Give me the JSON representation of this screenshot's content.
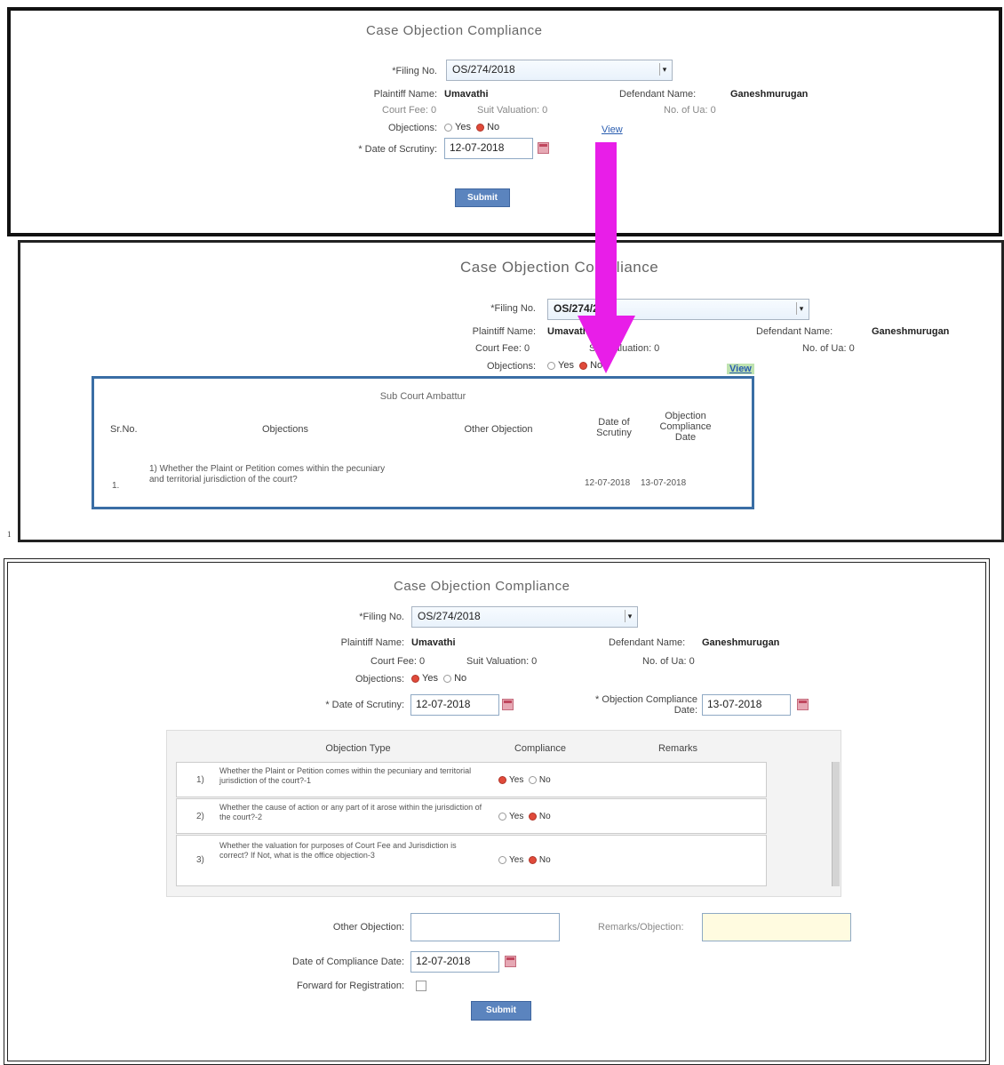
{
  "panel1": {
    "title": "Case Objection Compliance",
    "filing_label": "*Filing No.",
    "filing_value": "OS/274/2018",
    "plaintiff_label": "Plaintiff Name:",
    "plaintiff_value": "Umavathi",
    "defendant_label": "Defendant Name:",
    "defendant_value": "Ganeshmurugan",
    "court_fee": "Court Fee: 0",
    "suit_valuation": "Suit Valuation: 0",
    "no_of_ua": "No. of Ua: 0",
    "objections_label": "Objections:",
    "yes_label": "Yes",
    "no_label": "No",
    "view_link": "View",
    "date_label": "* Date of Scrutiny:",
    "date_value": "12-07-2018",
    "submit_label": "Submit"
  },
  "panel2": {
    "title": "Case Objection Compliance",
    "filing_label": "*Filing No.",
    "filing_value": "OS/274/2018",
    "plaintiff_label": "Plaintiff Name:",
    "plaintiff_value": "Umavathi",
    "defendant_label": "Defendant Name:",
    "defendant_value": "Ganeshmurugan",
    "court_fee": "Court Fee: 0",
    "suit_valuation": "Suit Valuation: 0",
    "no_of_ua": "No. of Ua: 0",
    "objections_label": "Objections:",
    "yes_label": "Yes",
    "no_label": "No",
    "view_link": "View",
    "popup": {
      "title": "Sub Court Ambattur",
      "headers": [
        "Sr.No.",
        "Objections",
        "Other Objection",
        "Date of Scrutiny",
        "Objection Compliance Date"
      ],
      "row": {
        "sr": "1.",
        "objection": "1) Whether the Plaint or Petition comes within the pecuniary and territorial jurisdiction of the court?",
        "other": "",
        "scrutiny_date": "12-07-2018",
        "compliance_date": "13-07-2018"
      }
    },
    "footnote": "1"
  },
  "panel3": {
    "title": "Case Objection Compliance",
    "filing_label": "*Filing No.",
    "filing_value": "OS/274/2018",
    "plaintiff_label": "Plaintiff Name:",
    "plaintiff_value": "Umavathi",
    "defendant_label": "Defendant Name:",
    "defendant_value": "Ganeshmurugan",
    "court_fee": "Court Fee: 0",
    "suit_valuation": "Suit Valuation: 0",
    "no_of_ua": "No. of Ua: 0",
    "objections_label": "Objections:",
    "yes_label": "Yes",
    "no_label": "No",
    "scrutiny_label": "* Date of Scrutiny:",
    "scrutiny_value": "12-07-2018",
    "compliance_label": "* Objection Compliance Date:",
    "compliance_value": "13-07-2018",
    "table_headers": [
      "Objection Type",
      "Compliance",
      "Remarks"
    ],
    "rows": [
      {
        "num": "1)",
        "text": "Whether the Plaint or Petition comes within the pecuniary and territorial jurisdiction of the court?-1",
        "selected": "yes"
      },
      {
        "num": "2)",
        "text": "Whether the cause of action or any part of it arose within the jurisdiction of the court?-2",
        "selected": "no"
      },
      {
        "num": "3)",
        "text": "Whether the valuation for purposes of Court Fee and Jurisdiction is correct? If Not, what is the office objection-3",
        "selected": "no"
      }
    ],
    "other_objection_label": "Other Objection:",
    "remarks_label": "Remarks/Objection:",
    "date_compliance_label": "Date of Compliance Date:",
    "date_compliance_value": "12-07-2018",
    "forward_label": "Forward for Registration:",
    "submit_label": "Submit"
  },
  "colors": {
    "arrow": "#e81ee8",
    "popup_border": "#3a6ea5",
    "frame": "#111111"
  }
}
